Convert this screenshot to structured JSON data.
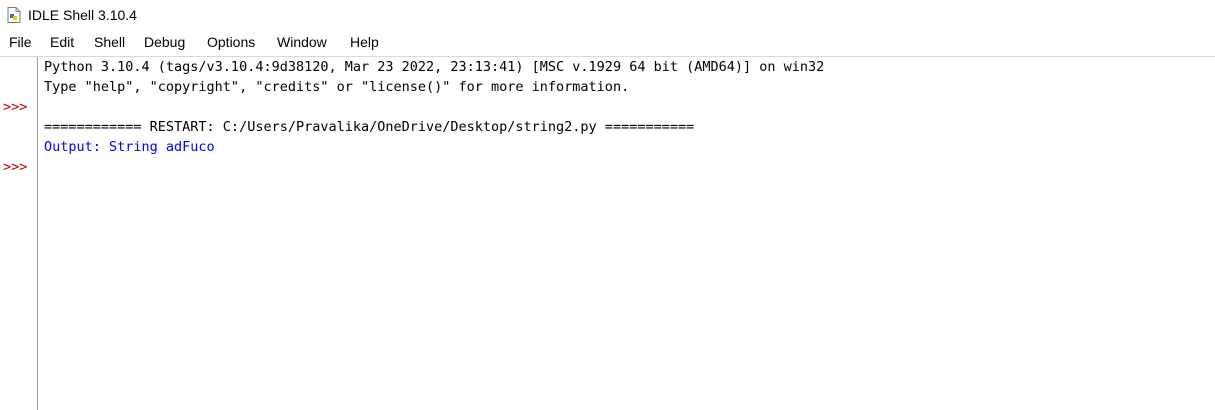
{
  "window": {
    "title": "IDLE Shell 3.10.4",
    "icon": "python-file-icon"
  },
  "menu": {
    "items": [
      "File",
      "Edit",
      "Shell",
      "Debug",
      "Options",
      "Window",
      "Help"
    ]
  },
  "shell": {
    "prompt": ">>>",
    "lines": [
      "Python 3.10.4 (tags/v3.10.4:9d38120, Mar 23 2022, 23:13:41) [MSC v.1929 64 bit (AMD64)] on win32",
      "Type \"help\", \"copyright\", \"credits\" or \"license()\" for more information.",
      "============ RESTART: C:/Users/Pravalika/OneDrive/Desktop/string2.py ===========",
      "Output: String adFuco"
    ]
  },
  "colors": {
    "prompt": "#c00000",
    "stdout": "#0000ff",
    "text": "#000000"
  }
}
